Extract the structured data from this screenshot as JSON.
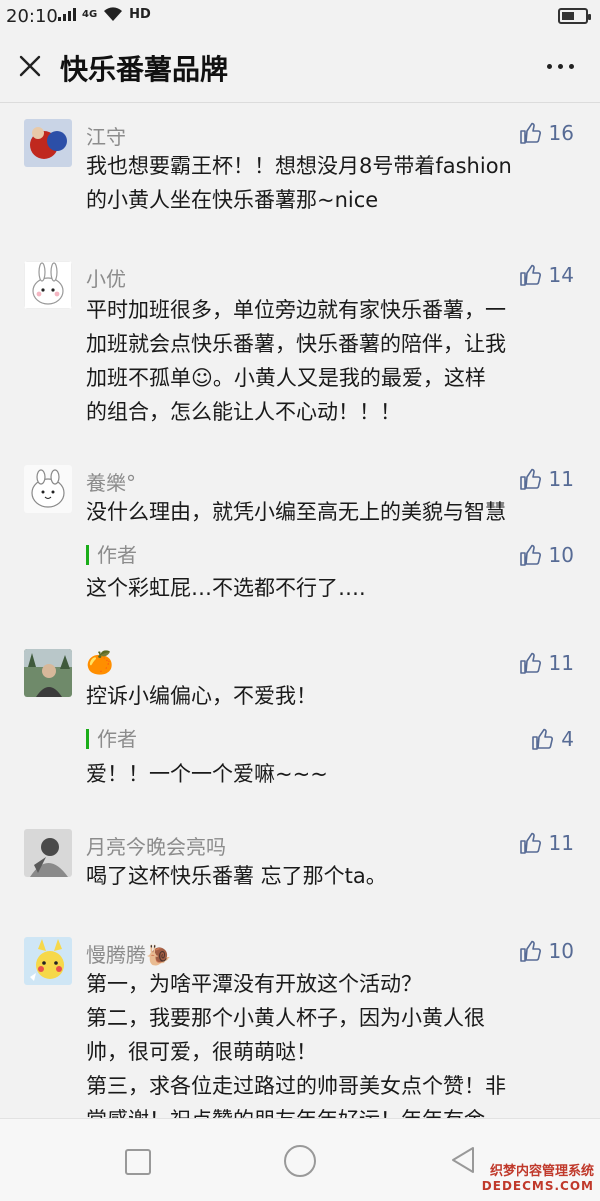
{
  "status": {
    "time": "20:10",
    "net": "4G",
    "hd": "HD",
    "battery_level": 0.55
  },
  "header": {
    "title": "快乐番薯品牌"
  },
  "comments": [
    {
      "nickname": "江守",
      "likes": "16",
      "lines": [
        "我也想要霸王杯！！想想没月8号带着fashion",
        "的小黄人坐在快乐番薯那~nice"
      ]
    },
    {
      "nickname": "小优",
      "likes": "14",
      "lines": [
        "平时加班很多，单位旁边就有家快乐番薯，一",
        "加班就会点快乐番薯，快乐番薯的陪伴，让我",
        "加班不孤单☺。小黄人又是我的最爱，这样",
        "的组合，怎么能让人不心动！！！"
      ]
    },
    {
      "nickname": "養樂°",
      "likes": "11",
      "lines": [
        "没什么理由，就凭小编至高无上的美貌与智慧"
      ],
      "reply": {
        "label": "作者",
        "likes": "10",
        "text": "这个彩虹屁…不选都不行了…."
      }
    },
    {
      "nickname": "🍊",
      "likes": "11",
      "lines": [
        "控诉小编偏心，不爱我！"
      ],
      "reply": {
        "label": "作者",
        "likes": "4",
        "text": "爱！！一个一个爱嘛~~~"
      }
    },
    {
      "nickname": "月亮今晚会亮吗",
      "likes": "11",
      "lines": [
        "喝了这杯快乐番薯 忘了那个ta。"
      ]
    },
    {
      "nickname": "慢腾腾🐌",
      "likes": "10",
      "lines": [
        "第一，为啥平潭没有开放这个活动？",
        "第二，我要那个小黄人杯子，因为小黄人很",
        "帅，很可爱，很萌萌哒！",
        "第三，求各位走过路过的帅哥美女点个赞！非",
        "常感谢！祝点赞的朋友年年好运！年年有余"
      ]
    }
  ],
  "watermark": {
    "line1": "织梦内容管理系统",
    "line2": "DEDECMS.COM"
  },
  "colors": {
    "like": "#576b95",
    "nickname": "#8c8c8c",
    "author_bar": "#1aad19",
    "background": "#f2f2f2"
  }
}
